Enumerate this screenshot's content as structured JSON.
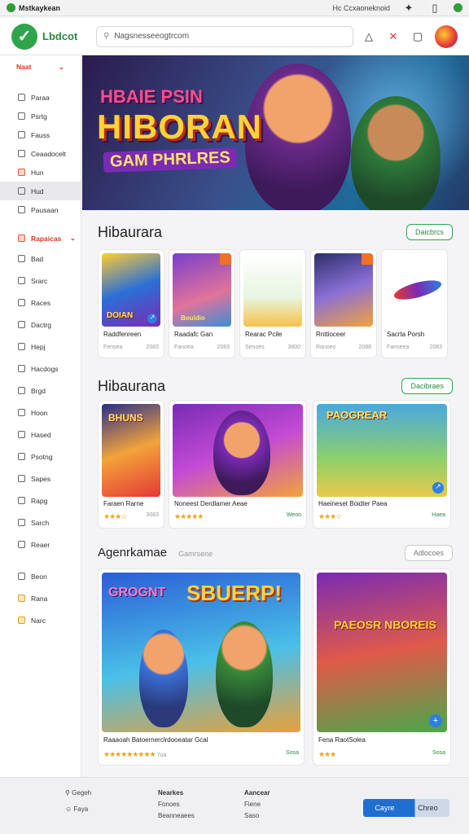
{
  "topbar": {
    "brand": "Mstkaykean",
    "right_text": "Hc Ccxaoneknoid"
  },
  "header": {
    "logo_text": "Lbdcot",
    "search_value": "Nagsnesseeogtrcom"
  },
  "sidebar": {
    "head": "Naat",
    "items": [
      "Paraa",
      "Psrtg",
      "Fauss",
      "Ceaadocelt",
      "Hun",
      "Hud",
      "Pausaan"
    ],
    "highlight": "Rapaicas",
    "items2": [
      "Bad",
      "Srarc",
      "Races",
      "Dactrg",
      "Hepj",
      "Hacdogs",
      "Brgd",
      "Hoon",
      "Hased",
      "Psotng",
      "Sapes",
      "Rapg",
      "Sarch",
      "Reaer"
    ],
    "items3": [
      "Beon",
      "Rana",
      "Narc"
    ]
  },
  "hero": {
    "line1": "HBAIE PSIN",
    "line2": "HIBORAN",
    "line3": "GAM PHRLRES"
  },
  "section1": {
    "title": "Hibaurara",
    "button": "Daicbrcs",
    "cards": [
      {
        "name": "Raddfenreen",
        "meta_left": "Fensea",
        "meta_right": "2083",
        "thumb_text": "DOIAN"
      },
      {
        "name": "Raadafc Gan",
        "meta_left": "Fanoea",
        "meta_right": "2083",
        "thumb_text": "Bouidio"
      },
      {
        "name": "Rearac Pcile",
        "meta_left": "Senoes",
        "meta_right": "3800"
      },
      {
        "name": "Rnttioceer",
        "meta_left": "Ranoeo",
        "meta_right": "2088"
      },
      {
        "name": "Sacrta Porsh",
        "meta_left": "Fanseea",
        "meta_right": "2083"
      }
    ]
  },
  "section2": {
    "title": "Hibaurana",
    "button": "Dacibraes",
    "cards": [
      {
        "name": "Faraen Rarne",
        "stars": "★★★☆",
        "meta": "3083",
        "thumb_text": "BHUNS"
      },
      {
        "name": "Noneest Derdlamer Aeae",
        "stars": "★★★★★",
        "meta": "Weoo"
      },
      {
        "name": "Haeineset Boidter Paea",
        "stars": "★★★☆",
        "meta": "Haea",
        "thumb_text": "PAOGREAR"
      }
    ]
  },
  "section3": {
    "title": "Agenrkamae",
    "subtitle": "Gamrsene",
    "button": "Adlocoes",
    "cards": [
      {
        "name": "Raaaoah Batoernerclrdooeatar Gcal",
        "stars": "★★★★★★★★★",
        "meta": "7oa",
        "price": "Sosa",
        "thumb_text": "SBUERP!",
        "thumb_text2": "GROGNT"
      },
      {
        "name": "Fena RaotSolea",
        "stars": "★★★",
        "price": "Sosa",
        "thumb_text": "PAEOSR NBOREIS"
      }
    ]
  },
  "footer": {
    "col1": [
      "Gegeh",
      "Faya"
    ],
    "col2_head": "Nearkes",
    "col2": [
      "Fonoes",
      "Beanneaees"
    ],
    "col3_head": "Aancear",
    "col3": [
      "Fiene",
      "Saso"
    ],
    "btn_left": "Cayre",
    "btn_right": "Chreo"
  },
  "colors": {
    "accent": "#2ea54a",
    "sidebar_highlight": "#d9361b",
    "star": "#e9a31b"
  }
}
